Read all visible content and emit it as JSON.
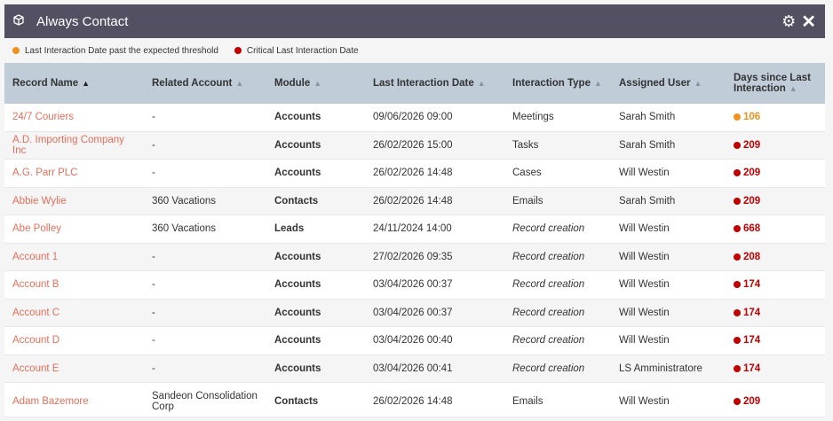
{
  "header": {
    "title": "Always Contact",
    "cube_icon": "cube-icon",
    "settings_icon": "gear-icon",
    "close_icon": "close-icon"
  },
  "legend": [
    {
      "label": "Last Interaction Date past the expected threshold",
      "color": "#f0921f"
    },
    {
      "label": "Critical Last Interaction Date",
      "color": "#c00000"
    }
  ],
  "columns": [
    {
      "label": "Record Name",
      "sort": "▲",
      "active": true
    },
    {
      "label": "Related Account",
      "sort": "▲",
      "active": false
    },
    {
      "label": "Module",
      "sort": "▲",
      "active": false
    },
    {
      "label": "Last Interaction Date",
      "sort": "▲",
      "active": false
    },
    {
      "label": "Interaction Type",
      "sort": "▲",
      "active": false
    },
    {
      "label": "Assigned User",
      "sort": "▲",
      "active": false
    },
    {
      "label": "Days since Last Interaction",
      "sort": "▲",
      "active": false
    }
  ],
  "rows": [
    {
      "name": "24/7 Couriers",
      "account": "-",
      "module": "Accounts",
      "date": "09/06/2026 09:00",
      "type": "Meetings",
      "type_italic": false,
      "user": "Sarah Smith",
      "days": "106",
      "status": "orange"
    },
    {
      "name": "A.D. Importing Company Inc",
      "account": "-",
      "module": "Accounts",
      "date": "26/02/2026 15:00",
      "type": "Tasks",
      "type_italic": false,
      "user": "Sarah Smith",
      "days": "209",
      "status": "red"
    },
    {
      "name": "A.G. Parr PLC",
      "account": "-",
      "module": "Accounts",
      "date": "26/02/2026 14:48",
      "type": "Cases",
      "type_italic": false,
      "user": "Will Westin",
      "days": "209",
      "status": "red"
    },
    {
      "name": "Abbie Wylie",
      "account": "360 Vacations",
      "module": "Contacts",
      "date": "26/02/2026 14:48",
      "type": "Emails",
      "type_italic": false,
      "user": "Sarah Smith",
      "days": "209",
      "status": "red"
    },
    {
      "name": "Abe Polley",
      "account": "360 Vacations",
      "module": "Leads",
      "date": "24/11/2024 14:00",
      "type": "Record creation",
      "type_italic": true,
      "user": "Will Westin",
      "days": "668",
      "status": "red"
    },
    {
      "name": "Account 1",
      "account": "-",
      "module": "Accounts",
      "date": "27/02/2026 09:35",
      "type": "Record creation",
      "type_italic": true,
      "user": "Will Westin",
      "days": "208",
      "status": "red"
    },
    {
      "name": "Account B",
      "account": "-",
      "module": "Accounts",
      "date": "03/04/2026 00:37",
      "type": "Record creation",
      "type_italic": true,
      "user": "Will Westin",
      "days": "174",
      "status": "red"
    },
    {
      "name": "Account C",
      "account": "-",
      "module": "Accounts",
      "date": "03/04/2026 00:37",
      "type": "Record creation",
      "type_italic": true,
      "user": "Will Westin",
      "days": "174",
      "status": "red"
    },
    {
      "name": "Account D",
      "account": "-",
      "module": "Accounts",
      "date": "03/04/2026 00:40",
      "type": "Record creation",
      "type_italic": true,
      "user": "Will Westin",
      "days": "174",
      "status": "red"
    },
    {
      "name": "Account E",
      "account": "-",
      "module": "Accounts",
      "date": "03/04/2026 00:41",
      "type": "Record creation",
      "type_italic": true,
      "user": "LS Amministratore",
      "days": "174",
      "status": "red"
    },
    {
      "name": "Adam Bazemore",
      "account": "Sandeon Consolidation Corp",
      "module": "Contacts",
      "date": "26/02/2026 14:48",
      "type": "Emails",
      "type_italic": false,
      "user": "Will Westin",
      "days": "209",
      "status": "red"
    }
  ]
}
